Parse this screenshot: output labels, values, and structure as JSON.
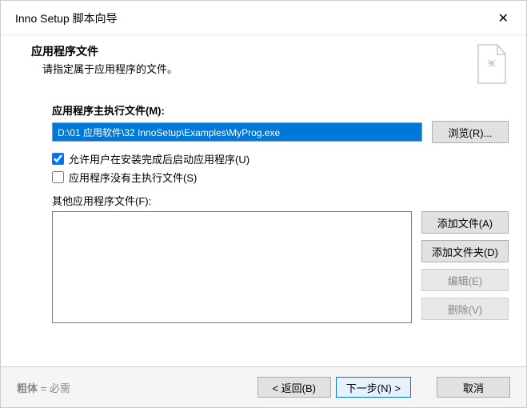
{
  "titlebar": {
    "title": "Inno Setup 脚本向导",
    "close": "✕"
  },
  "header": {
    "title": "应用程序文件",
    "sub": "请指定属于应用程序的文件。"
  },
  "mainExec": {
    "label": "应用程序主执行文件(M):",
    "value": "D:\\01 应用软件\\32 InnoSetup\\Examples\\MyProg.exe",
    "browse": "浏览(R)..."
  },
  "allowLaunch": {
    "label": "允许用户在安装完成后启动应用程序(U)"
  },
  "noMainExec": {
    "label": "应用程序没有主执行文件(S)"
  },
  "otherFiles": {
    "label": "其他应用程序文件(F):",
    "addFile": "添加文件(A)",
    "addFolder": "添加文件夹(D)",
    "edit": "编辑(E)",
    "remove": "删除(V)"
  },
  "footer": {
    "boldLabel": "粗体",
    "eq": "= 必需",
    "back": "< 返回(B)",
    "next": "下一步(N) >",
    "cancel": "取消"
  }
}
